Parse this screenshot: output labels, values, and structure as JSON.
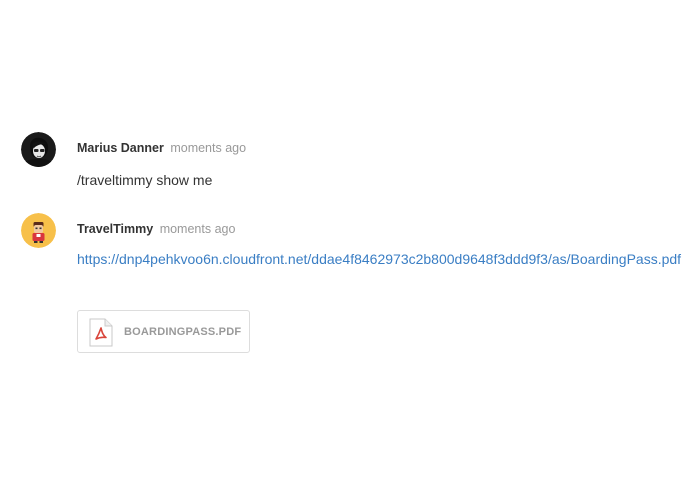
{
  "messages": [
    {
      "author": "Marius Danner",
      "time": "moments ago",
      "text": "/traveltimmy show me",
      "avatar_icon": "user-photo-icon"
    },
    {
      "author": "TravelTimmy",
      "time": "moments ago",
      "link": "https://dnp4pehkvoo6n.cloudfront.net/ddae4f8462973c2b800d9648f3ddd9f3/as/BoardingPass.pdf",
      "avatar_icon": "bot-avatar-icon",
      "attachment": {
        "name": "BOARDINGPASS.PDF",
        "icon": "pdf-file-icon"
      }
    }
  ],
  "colors": {
    "link": "#3a7ec4",
    "meta_time": "#999999",
    "bot_avatar_bg": "#f7c04a",
    "pdf_red": "#d9453b"
  }
}
